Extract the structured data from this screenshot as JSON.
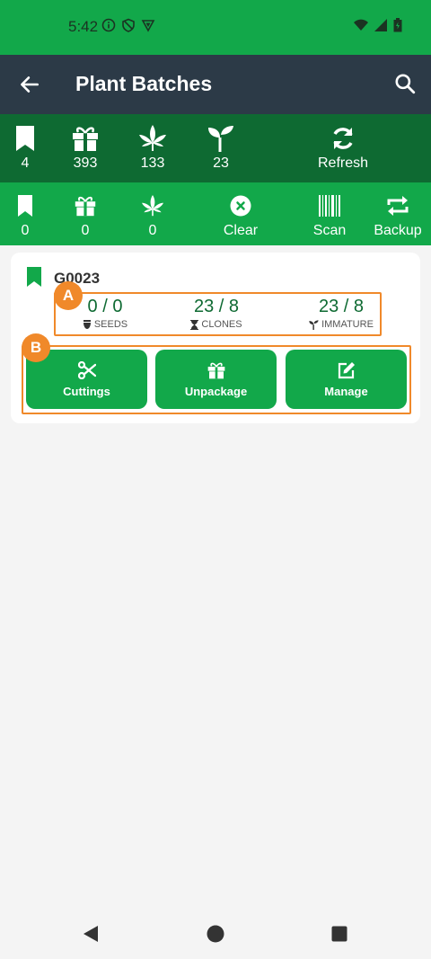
{
  "status_bar": {
    "time": "5:42"
  },
  "appbar": {
    "title": "Plant Batches"
  },
  "stats": [
    {
      "icon": "bookmark-icon",
      "value": "4"
    },
    {
      "icon": "gift-icon",
      "value": "393"
    },
    {
      "icon": "leaf-icon",
      "value": "133"
    },
    {
      "icon": "sprout-icon",
      "value": "23"
    },
    {
      "icon": "refresh-icon",
      "label": "Refresh"
    }
  ],
  "actions": [
    {
      "icon": "bookmark-icon",
      "value": "0"
    },
    {
      "icon": "gift-icon",
      "value": "0"
    },
    {
      "icon": "leaf-icon",
      "value": "0"
    },
    {
      "icon": "clear-icon",
      "label": "Clear"
    },
    {
      "icon": "barcode-icon",
      "label": "Scan"
    },
    {
      "icon": "swap-icon",
      "label": "Backup"
    }
  ],
  "batch": {
    "name": "G0023",
    "metrics": [
      {
        "value": "0 / 0",
        "label": "SEEDS",
        "icon": "seed-icon"
      },
      {
        "value": "23 / 8",
        "label": "CLONES",
        "icon": "hourglass-icon"
      },
      {
        "value": "23 / 8",
        "label": "IMMATURE",
        "icon": "sprout-icon"
      }
    ],
    "buttons": [
      {
        "label": "Cuttings",
        "icon": "scissors-icon"
      },
      {
        "label": "Unpackage",
        "icon": "gift-icon"
      },
      {
        "label": "Manage",
        "icon": "edit-icon"
      }
    ]
  },
  "annotations": {
    "a": "A",
    "b": "B"
  },
  "colors": {
    "dark_green": "#0e6a32",
    "green": "#12a84a",
    "appbar": "#2c3a47",
    "accent": "#f0892a"
  }
}
